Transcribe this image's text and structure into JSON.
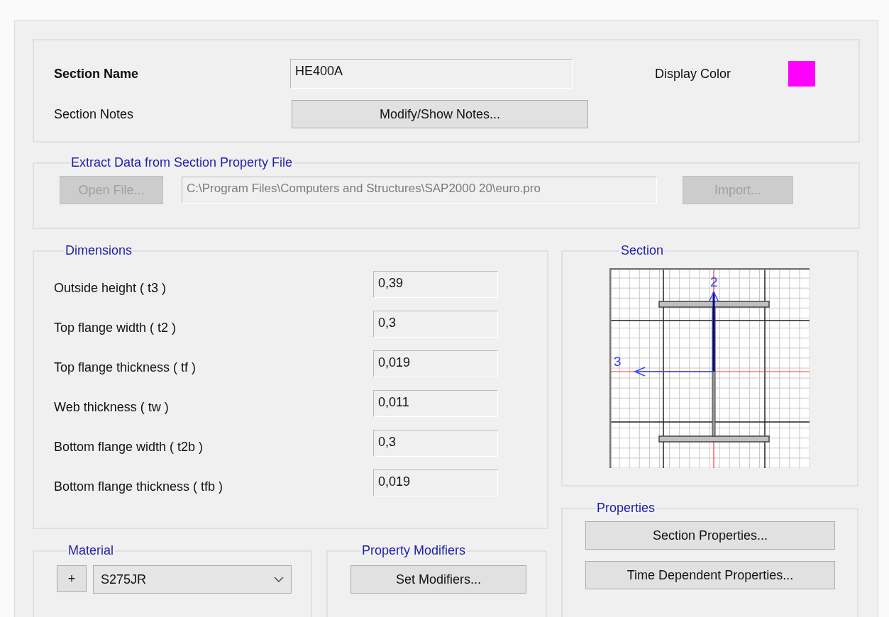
{
  "section_name": {
    "label": "Section Name",
    "value": "HE400A"
  },
  "display_color": {
    "label": "Display Color",
    "color": "#ff00ff"
  },
  "section_notes": {
    "label": "Section Notes",
    "button": "Modify/Show Notes..."
  },
  "extract": {
    "title": "Extract Data from Section Property File",
    "open_button": {
      "label": "Open File...",
      "disabled": true
    },
    "path": {
      "value": "C:\\Program Files\\Computers and Structures\\SAP2000 20\\euro.pro",
      "disabled": true
    },
    "import_button": {
      "label": "Import...",
      "disabled": true
    }
  },
  "dimensions": {
    "title": "Dimensions",
    "rows": [
      {
        "label": "Outside height  ( t3 )",
        "value": "0,39"
      },
      {
        "label": "Top flange width  ( t2 )",
        "value": "0,3"
      },
      {
        "label": "Top flange thickness  ( tf )",
        "value": "0,019"
      },
      {
        "label": "Web thickness  ( tw )",
        "value": "0,011"
      },
      {
        "label": "Bottom flange width  ( t2b )",
        "value": "0,3"
      },
      {
        "label": "Bottom flange thickness  ( tfb )",
        "value": "0,019"
      }
    ]
  },
  "section": {
    "title": "Section",
    "axis_labels": [
      "2",
      "3"
    ]
  },
  "material": {
    "title": "Material",
    "add_button": "+",
    "value": "S275JR"
  },
  "property_modifiers": {
    "title": "Property Modifiers",
    "button": "Set Modifiers..."
  },
  "properties": {
    "title": "Properties",
    "buttons": [
      "Section Properties...",
      "Time Dependent Properties..."
    ]
  }
}
